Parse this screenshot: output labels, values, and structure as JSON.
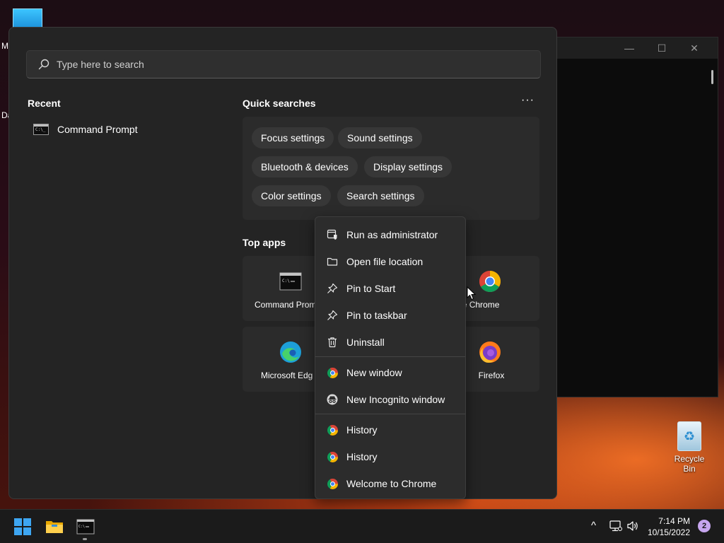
{
  "desktop": {
    "left_letters": [
      "M",
      "Da"
    ],
    "recycle_bin_label": "Recycle Bin"
  },
  "background_window": {
    "controls": [
      "—",
      "☐",
      "✕"
    ]
  },
  "start_menu": {
    "search": {
      "placeholder": "Type here to search"
    },
    "recent": {
      "title": "Recent",
      "items": [
        {
          "label": "Command Prompt",
          "icon": "command-prompt-icon"
        }
      ]
    },
    "quick_searches": {
      "title": "Quick searches",
      "more_label": "···",
      "chips": [
        "Focus settings",
        "Sound settings",
        "Bluetooth & devices",
        "Display settings",
        "Color settings",
        "Search settings"
      ]
    },
    "top_apps": {
      "title": "Top apps",
      "apps": [
        {
          "label": "Command Prom",
          "icon": "command-prompt-icon"
        },
        {
          "label": "oogle Chrome",
          "icon": "chrome-icon"
        },
        {
          "label": "Microsoft Edg",
          "icon": "edge-icon"
        },
        {
          "label": "Firefox",
          "icon": "firefox-icon"
        }
      ]
    }
  },
  "context_menu": {
    "items": [
      {
        "label": "Run as administrator",
        "icon": "shield-window-icon"
      },
      {
        "label": "Open file location",
        "icon": "folder-outline-icon"
      },
      {
        "label": "Pin to Start",
        "icon": "pin-icon"
      },
      {
        "label": "Pin to taskbar",
        "icon": "pin-icon"
      },
      {
        "label": "Uninstall",
        "icon": "trash-icon"
      },
      {
        "label": "New window",
        "icon": "chrome-icon"
      },
      {
        "label": "New Incognito window",
        "icon": "incognito-icon"
      },
      {
        "label": "History",
        "icon": "chrome-icon"
      },
      {
        "label": "History",
        "icon": "chrome-icon"
      },
      {
        "label": "Welcome to Chrome",
        "icon": "chrome-icon"
      }
    ]
  },
  "taskbar": {
    "tray_chevron": "^",
    "clock": {
      "time": "7:14 PM",
      "date": "10/15/2022"
    },
    "notification_count": "2"
  },
  "colors": {
    "menu_bg": "#242424",
    "panel_bg": "#2b2b2b",
    "accent": "#3ea6f2"
  }
}
